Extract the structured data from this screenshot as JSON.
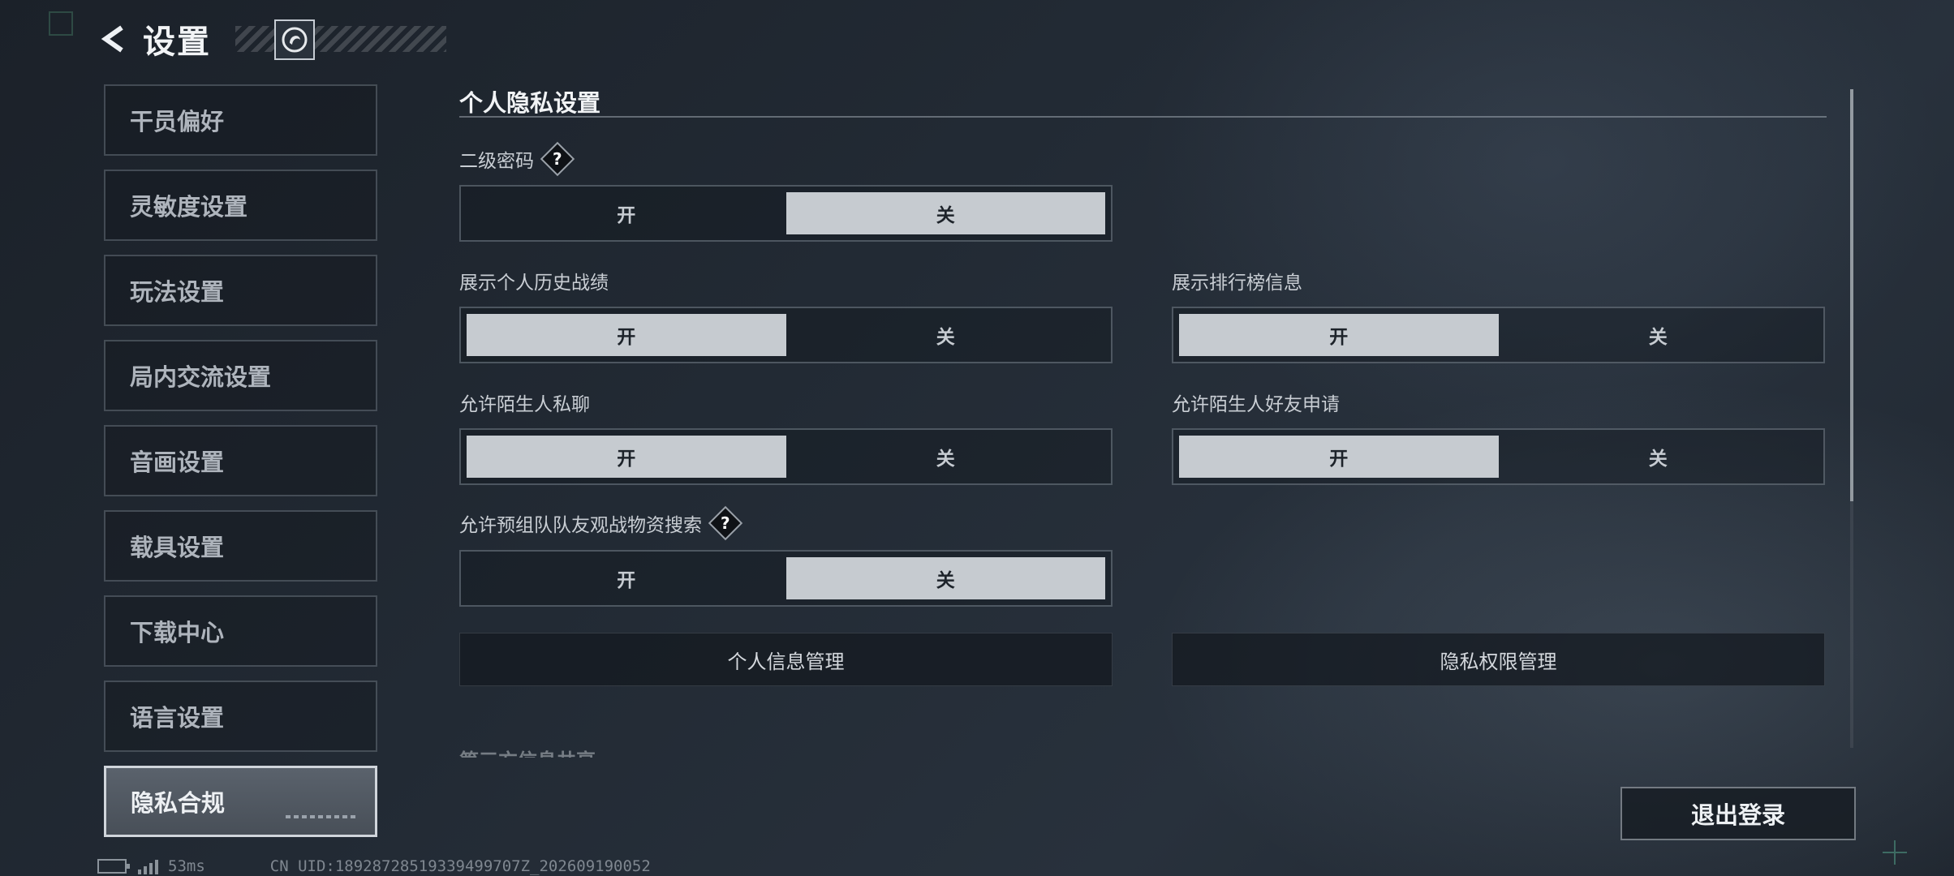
{
  "header": {
    "title": "设置",
    "back_icon": "chevron-left-icon",
    "profile_icon": "profile-badge-icon"
  },
  "sidebar": {
    "items": [
      {
        "label": "干员偏好",
        "active": false
      },
      {
        "label": "灵敏度设置",
        "active": false
      },
      {
        "label": "玩法设置",
        "active": false
      },
      {
        "label": "局内交流设置",
        "active": false
      },
      {
        "label": "音画设置",
        "active": false
      },
      {
        "label": "载具设置",
        "active": false
      },
      {
        "label": "下载中心",
        "active": false
      },
      {
        "label": "语言设置",
        "active": false
      },
      {
        "label": "隐私合规",
        "active": true
      }
    ]
  },
  "section": {
    "title": "个人隐私设置",
    "settings": [
      {
        "label": "二级密码",
        "has_help": true,
        "on_label": "开",
        "off_label": "关",
        "value": "关"
      },
      {
        "label": "展示个人历史战绩",
        "has_help": false,
        "on_label": "开",
        "off_label": "关",
        "value": "开"
      },
      {
        "label": "展示排行榜信息",
        "has_help": false,
        "on_label": "开",
        "off_label": "关",
        "value": "开"
      },
      {
        "label": "允许陌生人私聊",
        "has_help": false,
        "on_label": "开",
        "off_label": "关",
        "value": "开"
      },
      {
        "label": "允许陌生人好友申请",
        "has_help": false,
        "on_label": "开",
        "off_label": "关",
        "value": "开"
      },
      {
        "label": "允许预组队队友观战物资搜索",
        "has_help": true,
        "on_label": "开",
        "off_label": "关",
        "value": "关"
      }
    ],
    "help_symbol": "?",
    "buttons": {
      "personal_info": "个人信息管理",
      "privacy_permissions": "隐私权限管理"
    },
    "next_section_partial": "第三方信息共享"
  },
  "footer": {
    "logout": "退出登录",
    "ping": "53ms",
    "uid": "CN UID:18928728519339499707Z_202609190052"
  },
  "colors": {
    "toggle_on": "#c6cbd0",
    "background": "#222a34",
    "accent_mark": "#3d6b63"
  }
}
